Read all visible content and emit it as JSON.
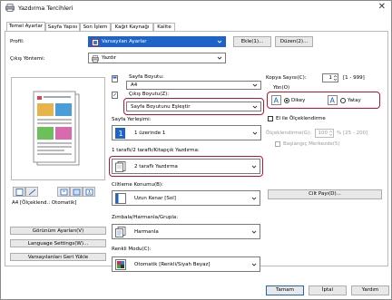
{
  "window": {
    "title": "Yazdırma Tercihleri",
    "close_glyph": "✕"
  },
  "tabs": [
    {
      "label": "Temel Ayarlar",
      "active": true
    },
    {
      "label": "Sayfa Yapısı"
    },
    {
      "label": "Son İşlem"
    },
    {
      "label": "Kağıt Kaynağı"
    },
    {
      "label": "Kalite"
    }
  ],
  "profile": {
    "label": "Profil:",
    "value": "Varsayılan Ayarlar",
    "add_label": "Ekle(1)...",
    "edit_label": "Düzen(2)..."
  },
  "output": {
    "label": "Çıkış Yöntemi:",
    "value": "Yazdır"
  },
  "page_size": {
    "label": "Sayfa Boyutu:",
    "value": "A4"
  },
  "output_size": {
    "label": "Çıkış Boyutu(Z):",
    "value": "Sayfa Boyutunu Eşleştir"
  },
  "copies": {
    "label": "Kopya Sayısı(C):",
    "value": "1",
    "range": "[1 - 999]"
  },
  "orientation": {
    "label": "Yön(O)",
    "portrait": "Dikey",
    "landscape": "Yatay",
    "selected": "portrait"
  },
  "page_layout": {
    "label": "Sayfa Yerleşimi:",
    "value": "1 üzerinde 1"
  },
  "manual_scale": {
    "label": "El ile Ölçeklendirme",
    "scale_label": "Ölçeklendirme(G):",
    "scale_value": "100",
    "scale_range": "% [25 - 200]",
    "center_label": "Başlangıç Merkezde(5)"
  },
  "duplex": {
    "label": "1 taraflı/2 taraflı/Kitapçık Yazdırma:",
    "value": "2 taraflı Yazdırma"
  },
  "binding": {
    "label": "Ciltleme Konumu(B):",
    "value": "Uzun Kenar [Sol]",
    "gutter_label": "Cilt Payı(D)..."
  },
  "finishing": {
    "label": "Zımbala/Harmanla/Grupla:",
    "value": "Harmanla"
  },
  "color_mode": {
    "label": "Renkli Modu(C):",
    "value": "Otomatik [Renkli/Siyah Beyaz]"
  },
  "preview": {
    "caption": "A4 [Ölçeklend.: Otomatik]"
  },
  "side_buttons": {
    "view": "Görünüm Ayarları(V)",
    "language": "Language Settings(W)...",
    "restore": "Varsayılanları Geri Yükle"
  },
  "footer": {
    "ok": "Tamam",
    "cancel": "İptal",
    "help": "Yardım"
  },
  "colors": {
    "highlight": "#c8102e",
    "accent": "#1e64c8"
  }
}
